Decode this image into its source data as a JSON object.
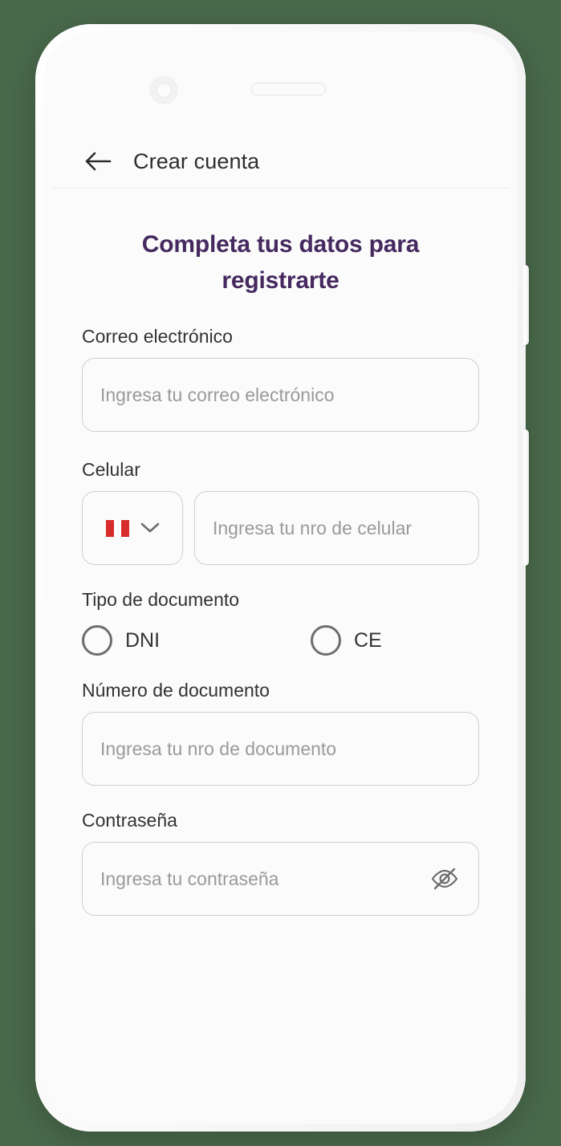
{
  "app": {
    "header": {
      "back_icon": "arrow-left-icon",
      "title": "Crear cuenta"
    },
    "heading": "Completa tus datos para registrarte",
    "fields": {
      "email": {
        "label": "Correo electrónico",
        "placeholder": "Ingresa tu correo electrónico",
        "value": ""
      },
      "phone": {
        "label": "Celular",
        "country_flag": "peru-flag-icon",
        "country_chevron": "chevron-down-icon",
        "placeholder": "Ingresa tu nro de celular",
        "value": ""
      },
      "doc_type": {
        "label": "Tipo de documento",
        "options": [
          {
            "label": "DNI",
            "selected": false
          },
          {
            "label": "CE",
            "selected": false
          }
        ]
      },
      "doc_number": {
        "label": "Número de documento",
        "placeholder": "Ingresa tu nro de documento",
        "value": ""
      },
      "password": {
        "label": "Contraseña",
        "placeholder": "Ingresa tu contraseña",
        "value": "",
        "toggle_icon": "eye-off-icon"
      }
    }
  },
  "colors": {
    "heading": "#45295f",
    "page_background": "#4a6a4c",
    "screen_background": "#fbfbfb",
    "input_border": "#cfcfcf",
    "placeholder": "#9a9a9a",
    "flag_red": "#d82c2c"
  }
}
